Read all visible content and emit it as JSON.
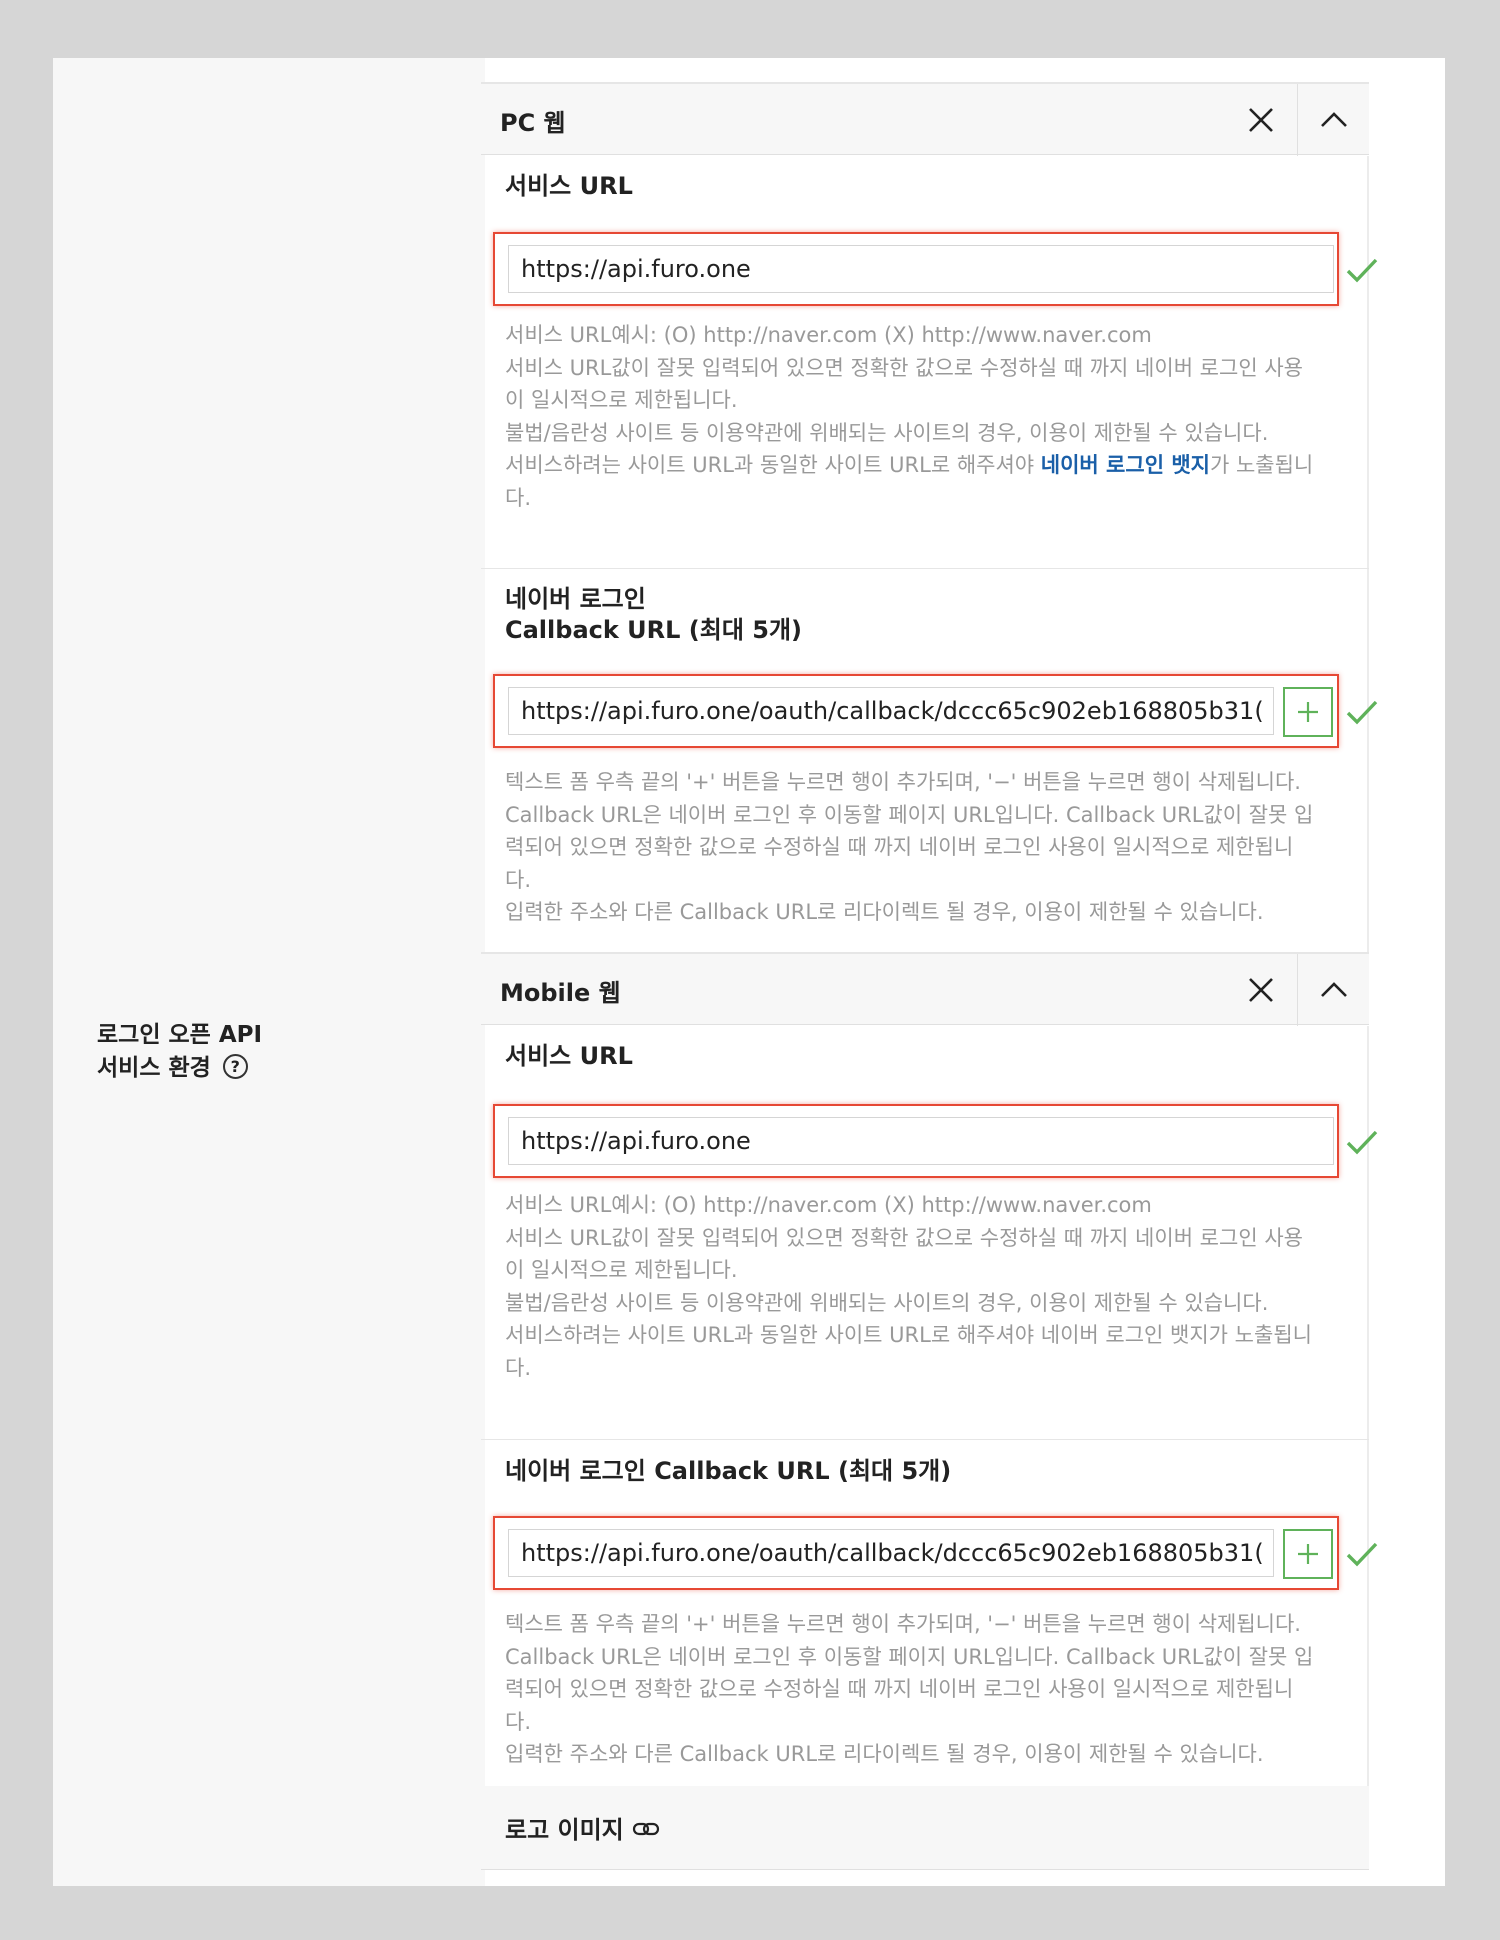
{
  "side": {
    "label_line1": "로그인 오픈 API",
    "label_line2": "서비스 환경",
    "help_icon": "question-circle-icon"
  },
  "pc": {
    "title": "PC 웹",
    "service_url_label": "서비스 URL",
    "service_url_value": "https://api.furo.one",
    "service_help_1": "서비스 URL예시: (O) http://naver.com (X) http://www.naver.com",
    "service_help_2": "서비스 URL값이 잘못 입력되어 있으면 정확한 값으로 수정하실 때 까지 네이버 로그인 사용",
    "service_help_3": "이 일시적으로 제한됩니다.",
    "service_help_4": "불법/음란성 사이트 등 이용약관에 위배되는 사이트의 경우, 이용이 제한될 수 있습니다.",
    "service_help_5a": "서비스하려는 사이트 URL과 동일한 사이트 URL로 해주셔야 ",
    "service_help_5_link": "네이버 로그인 뱃지",
    "service_help_5b": "가 노출됩니",
    "service_help_6": "다.",
    "callback_label_1": "네이버 로그인",
    "callback_label_2": "Callback URL (최대 5개)",
    "callback_value": "https://api.furo.one/oauth/callback/dccc65c902eb168805b31(",
    "callback_help_1": "텍스트 폼 우측 끝의 '+' 버튼을 누르면 행이 추가되며, '−' 버튼을 누르면 행이 삭제됩니다.",
    "callback_help_2": "Callback URL은 네이버 로그인 후 이동할 페이지 URL입니다. Callback URL값이 잘못 입",
    "callback_help_3": "력되어 있으면 정확한 값으로 수정하실 때 까지 네이버 로그인 사용이 일시적으로 제한됩니",
    "callback_help_4": "다.",
    "callback_help_5": "입력한 주소와 다른 Callback URL로 리다이렉트 될 경우, 이용이 제한될 수 있습니다."
  },
  "mobile": {
    "title": "Mobile 웹",
    "service_url_label": "서비스 URL",
    "service_url_value": "https://api.furo.one",
    "service_help_1": "서비스 URL예시: (O) http://naver.com (X) http://www.naver.com",
    "service_help_2": "서비스 URL값이 잘못 입력되어 있으면 정확한 값으로 수정하실 때 까지 네이버 로그인 사용",
    "service_help_3": "이 일시적으로 제한됩니다.",
    "service_help_4": "불법/음란성 사이트 등 이용약관에 위배되는 사이트의 경우, 이용이 제한될 수 있습니다.",
    "service_help_5": "서비스하려는 사이트 URL과 동일한 사이트 URL로 해주셔야 네이버 로그인 뱃지가 노출됩니",
    "service_help_6": "다.",
    "callback_label": "네이버 로그인 Callback URL (최대 5개)",
    "callback_value": "https://api.furo.one/oauth/callback/dccc65c902eb168805b31(",
    "callback_help_1": "텍스트 폼 우측 끝의 '+' 버튼을 누르면 행이 추가되며, '−' 버튼을 누르면 행이 삭제됩니다.",
    "callback_help_2": "Callback URL은 네이버 로그인 후 이동할 페이지 URL입니다. Callback URL값이 잘못 입",
    "callback_help_3": "력되어 있으면 정확한 값으로 수정하실 때 까지 네이버 로그인 사용이 일시적으로 제한됩니",
    "callback_help_4": "다.",
    "callback_help_5": "입력한 주소와 다른 Callback URL로 리다이렉트 될 경우, 이용이 제한될 수 있습니다."
  },
  "logo": {
    "title": "로고 이미지",
    "icon": "link-icon"
  },
  "colors": {
    "error_border": "#e64834",
    "valid_check": "#5fb25a",
    "link": "#1a5fa8"
  }
}
